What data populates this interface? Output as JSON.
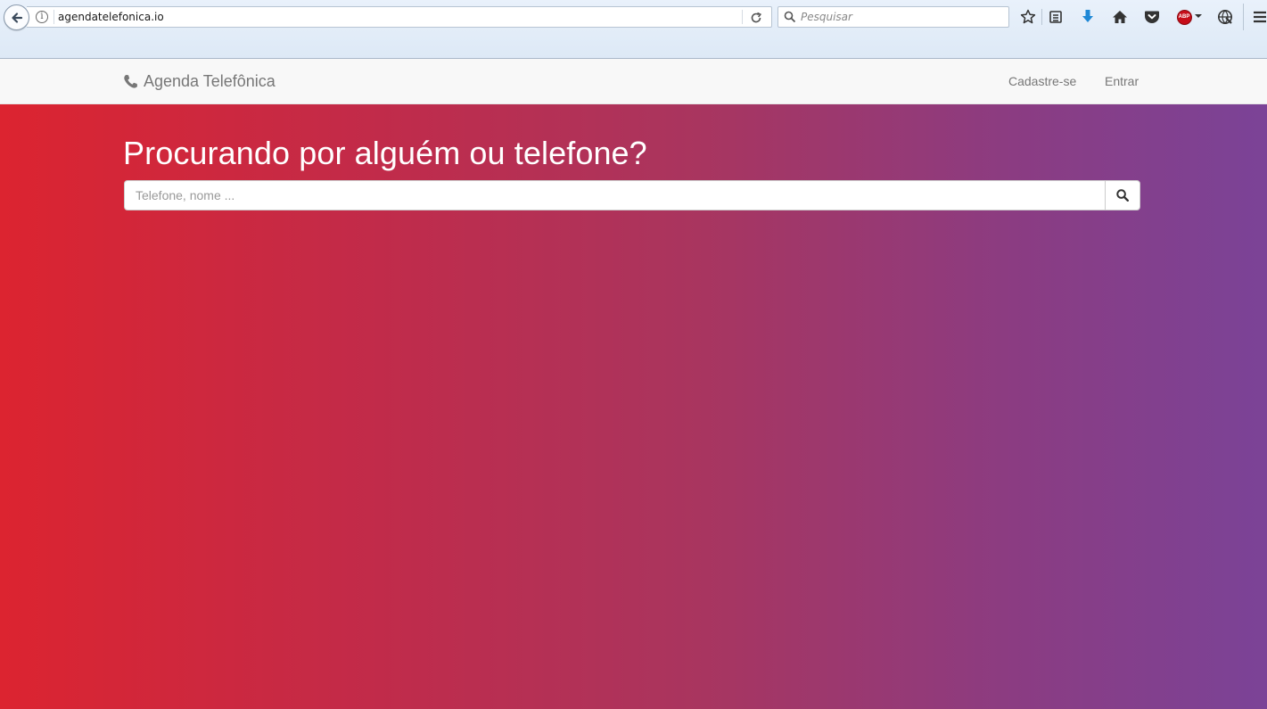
{
  "browser": {
    "url": "agendatelefonica.io",
    "search_placeholder": "Pesquisar",
    "abp_label": "ABP"
  },
  "navbar": {
    "brand": "Agenda Telefônica",
    "links": {
      "signup": "Cadastre-se",
      "login": "Entrar"
    }
  },
  "hero": {
    "title": "Procurando por alguém ou telefone?",
    "search_placeholder": "Telefone, nome ..."
  },
  "colors": {
    "gradient_start": "#dc2430",
    "gradient_end": "#7b4397",
    "navbar_bg": "#f8f8f8",
    "nav_text": "#777777"
  }
}
